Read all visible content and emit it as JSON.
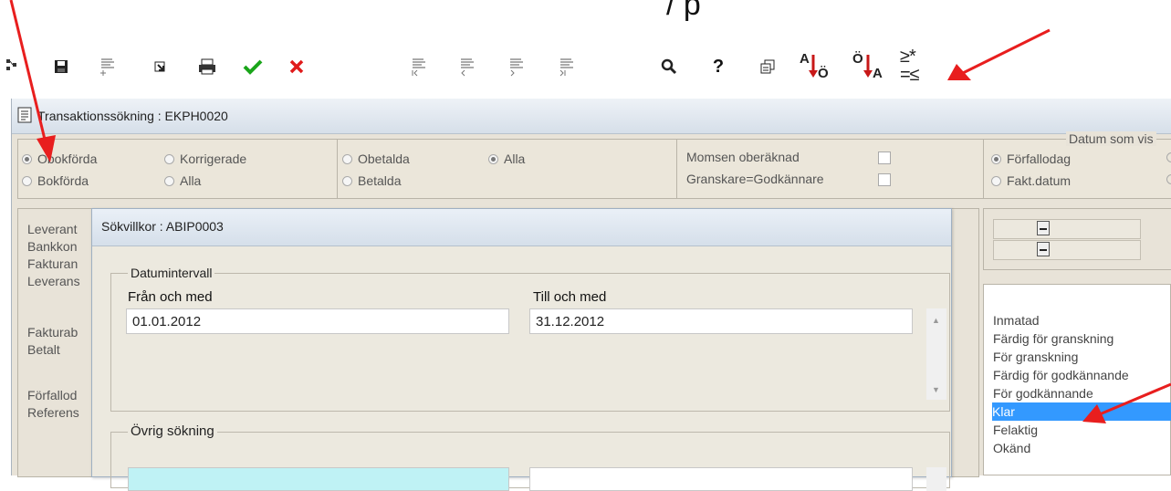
{
  "top_text": "/ p",
  "colors": {
    "accent_red": "#e81e1e",
    "selection": "#3399ff",
    "check_green": "#1aa51a",
    "cancel_red": "#e01b1b"
  },
  "toolbar": {
    "buttons": [
      {
        "icon": "tree-icon"
      },
      {
        "icon": "save-icon"
      },
      {
        "icon": "insert-row-icon"
      },
      {
        "icon": "jump-icon"
      },
      {
        "icon": "print-icon"
      },
      {
        "icon": "accept-icon"
      },
      {
        "icon": "cancel-icon"
      },
      {
        "icon": "first-record-icon"
      },
      {
        "icon": "previous-record-icon"
      },
      {
        "icon": "next-record-icon"
      },
      {
        "icon": "last-record-icon"
      },
      {
        "icon": "search-icon"
      },
      {
        "icon": "help-icon"
      },
      {
        "icon": "copy-window-icon"
      }
    ],
    "sort_asc": {
      "top": "A",
      "bottom": "Ö"
    },
    "sort_desc": {
      "top": "Ö",
      "bottom": "A"
    },
    "compare": {
      "top": "≥*",
      "bottom": "=≤"
    }
  },
  "main_window": {
    "title": "Transaktionssökning : EKPH0020",
    "group1": {
      "options": [
        {
          "label": "Obokförda",
          "selected": true
        },
        {
          "label": "Korrigerade",
          "selected": false
        },
        {
          "label": "Bokförda",
          "selected": false
        },
        {
          "label": "Alla",
          "selected": false
        }
      ]
    },
    "group2": {
      "options": [
        {
          "label": "Obetalda",
          "selected": false
        },
        {
          "label": "Alla",
          "selected": true
        },
        {
          "label": "Betalda",
          "selected": false
        }
      ]
    },
    "group3": {
      "momsen": "Momsen oberäknad",
      "granskare": "Granskare=Godkännare"
    },
    "group4": {
      "title": "Datum som vis",
      "options": [
        {
          "label": "Förfallodag",
          "selected": true
        },
        {
          "label": "Fakt.datum",
          "selected": false
        }
      ]
    },
    "left_labels": [
      "Leverant",
      "Bankkon",
      "Fakturan",
      "Leverans",
      "Fakturab",
      "Betalt",
      "Förfallod",
      "Referens"
    ],
    "status_list": {
      "items": [
        "Inmatad",
        "Färdig för granskning",
        "För granskning",
        "Färdig för godkännande",
        "För godkännande",
        "Klar",
        "Felaktig",
        "Okänd"
      ],
      "selected_index": 5
    }
  },
  "dialog": {
    "title": "Sökvillkor : ABIP0003",
    "date_interval": {
      "legend": "Datumintervall",
      "from_label": "Från och med",
      "from_value": "01.01.2012",
      "to_label": "Till och med",
      "to_value": "31.12.2012"
    },
    "other_search": {
      "legend": "Övrig sökning"
    }
  }
}
